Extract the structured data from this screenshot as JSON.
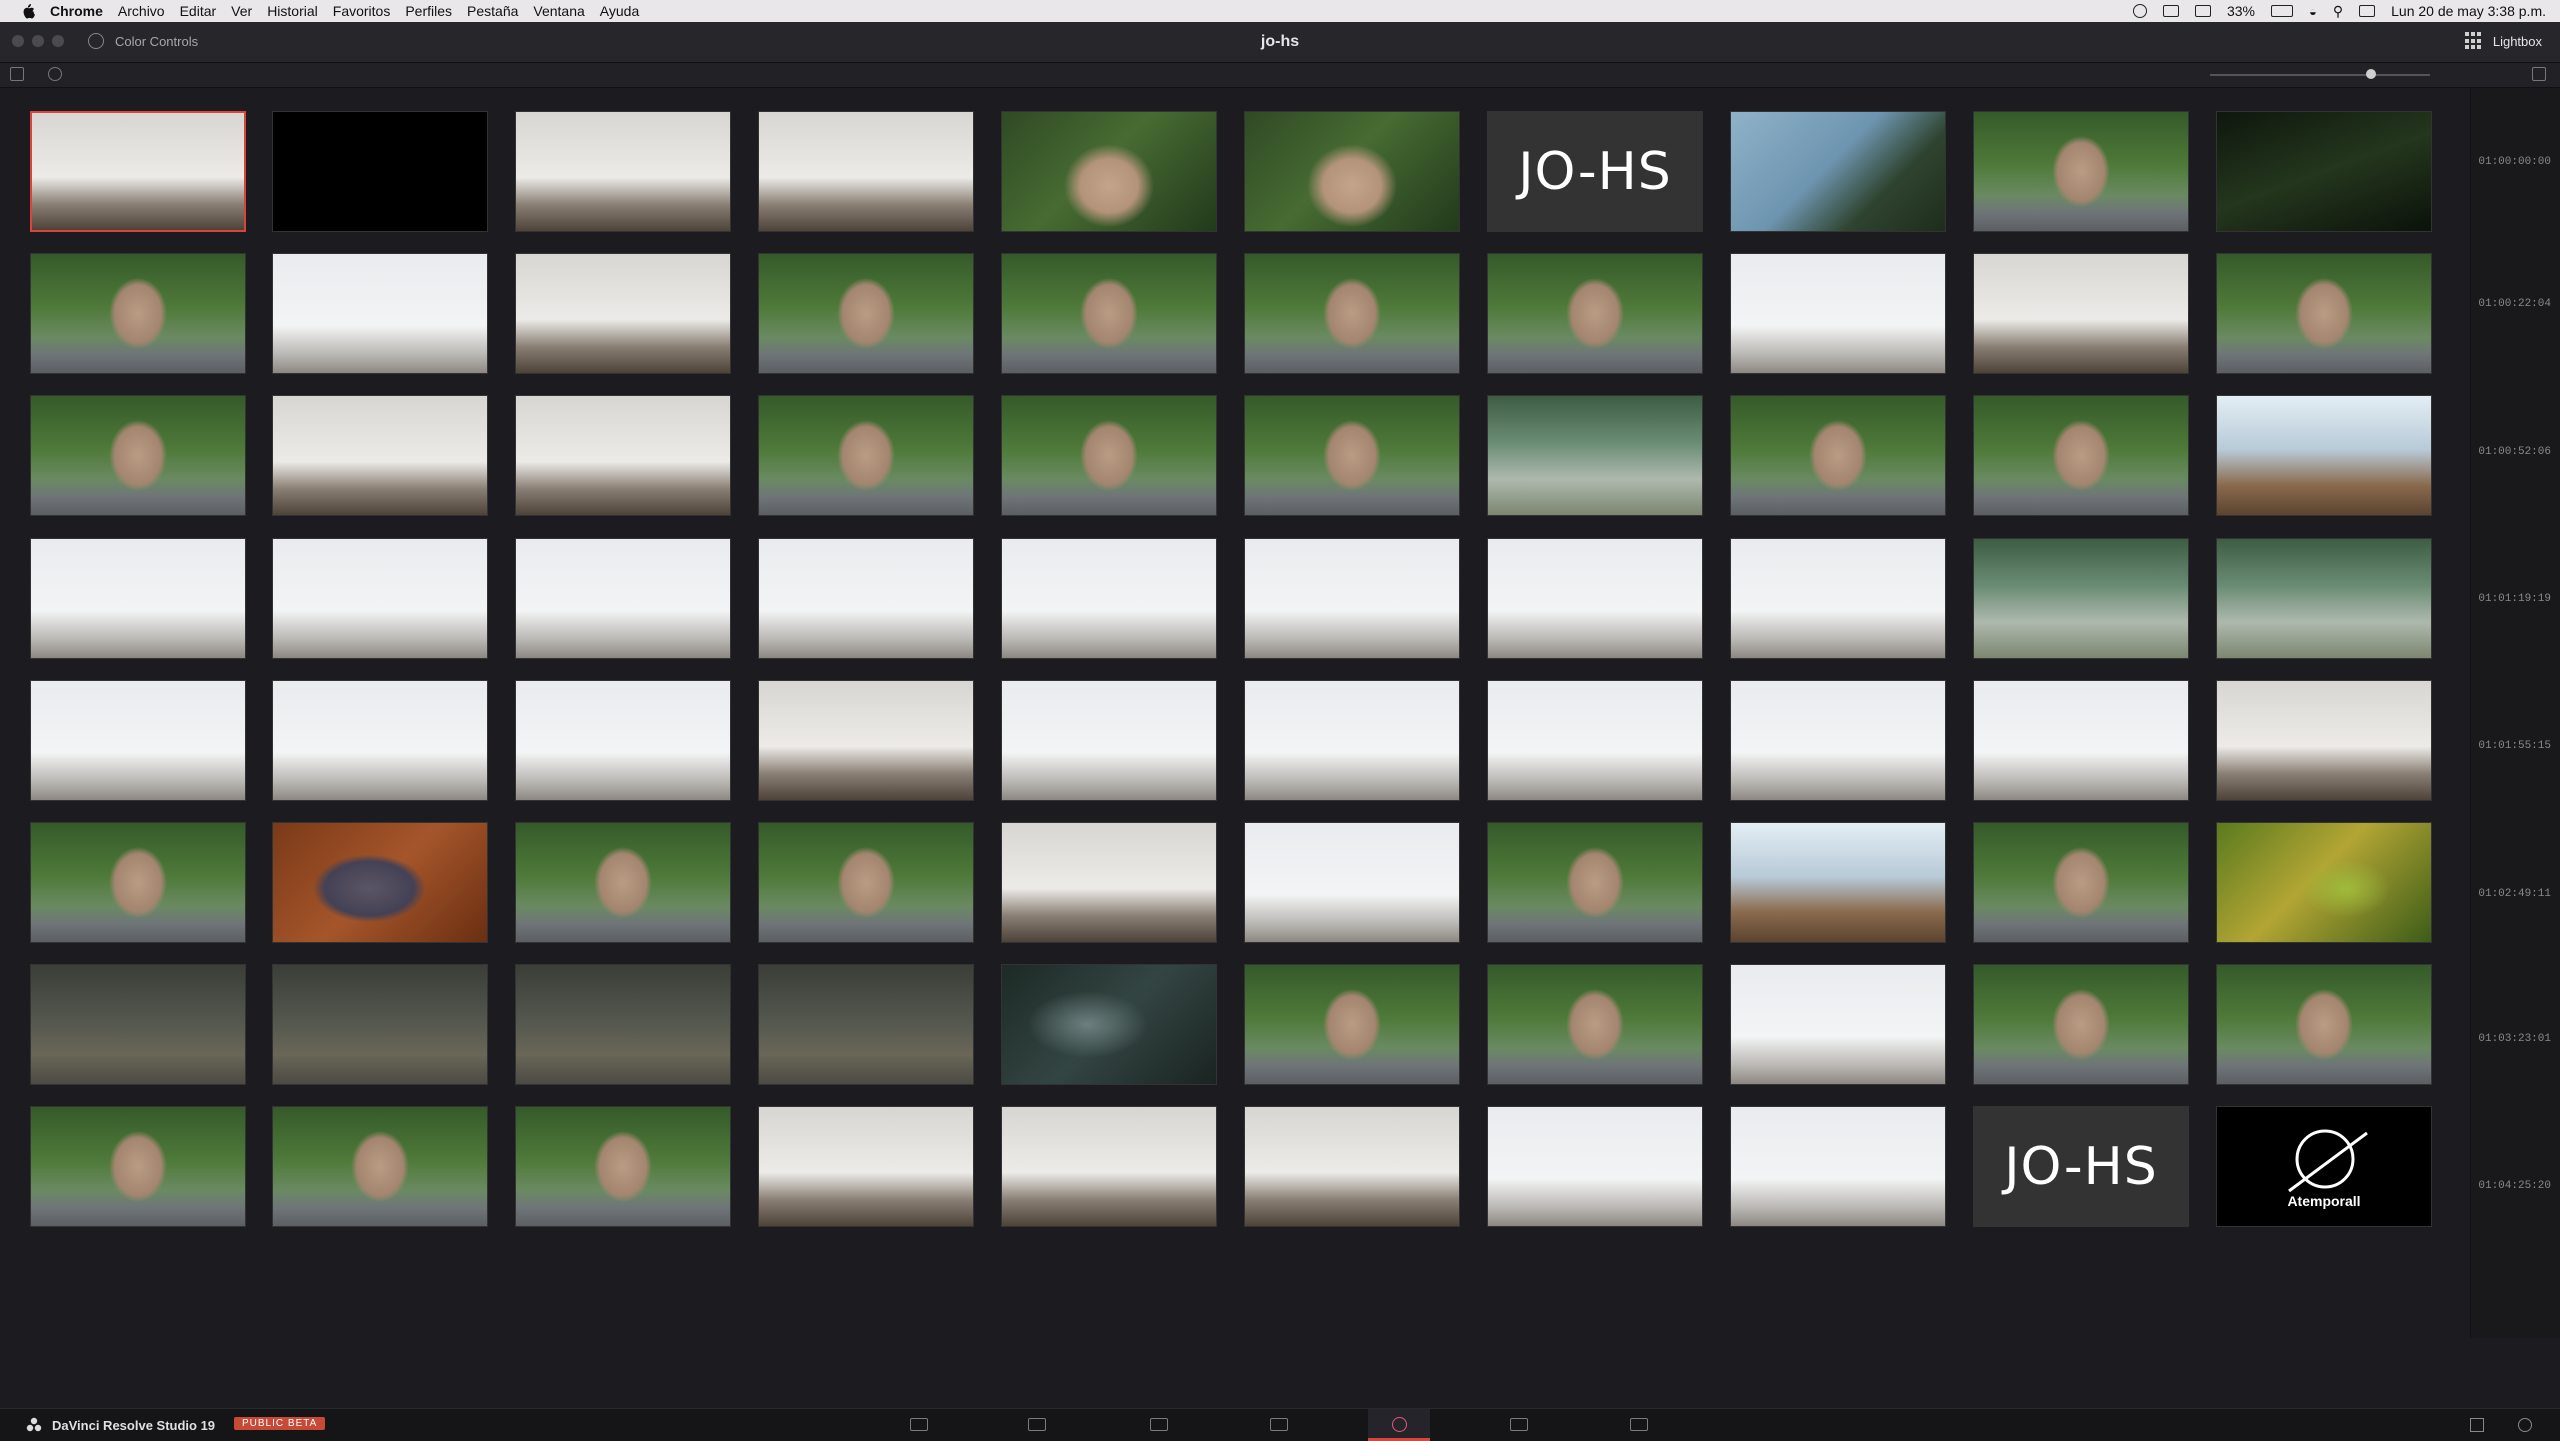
{
  "menubar": {
    "items": [
      "Chrome",
      "Archivo",
      "Editar",
      "Ver",
      "Historial",
      "Favoritos",
      "Perfiles",
      "Pestaña",
      "Ventana",
      "Ayuda"
    ],
    "battery": "33%",
    "datetime": "Lun 20 de may  3:38 p.m."
  },
  "titlebar": {
    "panel": "Color Controls",
    "project": "jo-hs",
    "lightbox_label": "Lightbox"
  },
  "timecodes": [
    "01:00:00:00",
    "01:00:22:04",
    "01:00:52:06",
    "01:01:19:19",
    "01:01:55:15",
    "01:02:49:11",
    "01:03:23:01",
    "01:04:25:20"
  ],
  "thumb_text": {
    "title_card": "JO-HS",
    "brand": "Atemporall"
  },
  "thumb_kinds": [
    [
      "gallery",
      "black",
      "gallery",
      "gallery",
      "portrait",
      "portrait",
      "title",
      "sky",
      "garden",
      "dark"
    ],
    [
      "garden",
      "white",
      "gallery",
      "garden",
      "garden",
      "garden",
      "garden",
      "white",
      "gallery",
      "garden"
    ],
    [
      "garden",
      "gallery",
      "gallery",
      "garden",
      "garden",
      "garden",
      "pool",
      "garden",
      "garden",
      "interior"
    ],
    [
      "white",
      "white",
      "white",
      "white",
      "white",
      "white",
      "white",
      "white",
      "pool",
      "pool"
    ],
    [
      "white",
      "white",
      "white",
      "gallery",
      "white",
      "white",
      "white",
      "white",
      "white",
      "gallery"
    ],
    [
      "garden",
      "wood",
      "garden",
      "garden",
      "gallery",
      "white",
      "garden",
      "interior",
      "garden",
      "leaves"
    ],
    [
      "concrete",
      "concrete",
      "concrete",
      "concrete",
      "fog",
      "garden",
      "garden",
      "white",
      "garden",
      "garden"
    ],
    [
      "garden",
      "garden",
      "garden",
      "gallery",
      "gallery",
      "gallery",
      "white",
      "white",
      "title",
      "brand"
    ]
  ],
  "pagebar": {
    "app_name": "DaVinci Resolve Studio 19",
    "badge": "PUBLIC BETA"
  }
}
